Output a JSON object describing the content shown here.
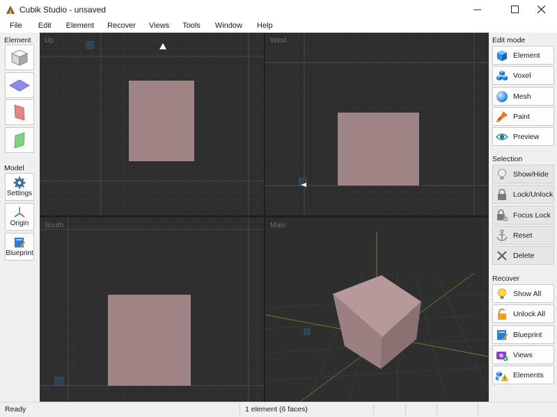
{
  "window": {
    "title": "Cubik Studio - unsaved"
  },
  "menu": [
    "File",
    "Edit",
    "Element",
    "Recover",
    "Views",
    "Tools",
    "Window",
    "Help"
  ],
  "left_panel": {
    "element_title": "Element",
    "model_title": "Model",
    "model_tools": [
      {
        "label": "Settings",
        "icon": "gear-icon"
      },
      {
        "label": "Origin",
        "icon": "axes-icon"
      },
      {
        "label": "Blueprint",
        "icon": "blueprint-icon"
      }
    ]
  },
  "viewports": {
    "up": "Up",
    "west": "West",
    "south": "South",
    "main": "Main"
  },
  "right_panel": {
    "edit_mode": {
      "title": "Edit mode",
      "items": [
        "Element",
        "Voxel",
        "Mesh",
        "Paint",
        "Preview"
      ]
    },
    "selection": {
      "title": "Selection",
      "items": [
        "Show/Hide",
        "Lock/Unlock",
        "Focus Lock",
        "Reset",
        "Delete"
      ]
    },
    "recover": {
      "title": "Recover",
      "items": [
        "Show All",
        "Unlock All",
        "Blueprint",
        "Views",
        "Elements"
      ]
    }
  },
  "status": {
    "ready": "Ready",
    "count": "1 element (6 faces)"
  },
  "colors": {
    "viewport_bg": "#2e2e2e",
    "element_fill": "#9e8484",
    "accent_blue": "#2a7fd4"
  }
}
